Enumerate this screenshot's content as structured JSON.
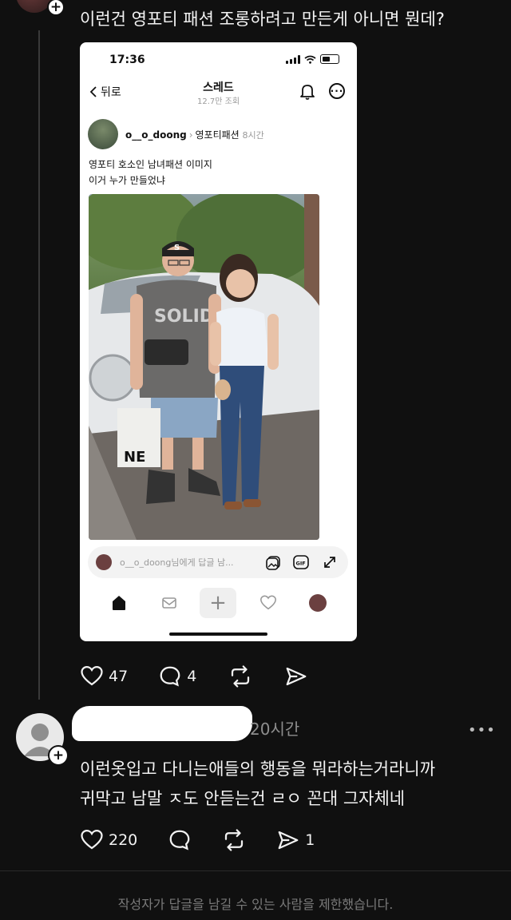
{
  "post": {
    "text": "이런건 영포티 패션 조롱하려고 만든게 아니면 뭔데?"
  },
  "screenshot": {
    "status_time": "17:36",
    "back_label": "뒤로",
    "title": "스레드",
    "views": "12.7만 조회",
    "username": "o__o_doong",
    "topic": "영포티패션",
    "time_ago": "8시간",
    "body_line1": "영포티 호소인 남녀패션 이미지",
    "body_line2": "이거 누가 만들었냐",
    "shirt_text": "SOLID",
    "cap_letter": "S",
    "bag_text": "NE",
    "reply_placeholder": "o__o_doong님에게 답글 남...",
    "gif_label": "GIF"
  },
  "post_actions": {
    "likes": "47",
    "comments": "4"
  },
  "comment": {
    "time": "20시간",
    "line1": "이런옷입고 다니는애들의 행동을 뭐라하는거라니까",
    "line2": "귀막고 남말 ㅈ도 안듣는건 ㄹㅇ 꼰대 그자체네",
    "likes": "220",
    "shares": "1"
  },
  "footer": {
    "notice": "작성자가 답글을 남길 수 있는 사람을 제한했습니다."
  },
  "colors": {
    "background": "#101010",
    "text": "#f2f2f2",
    "muted": "#8e8e8e"
  }
}
